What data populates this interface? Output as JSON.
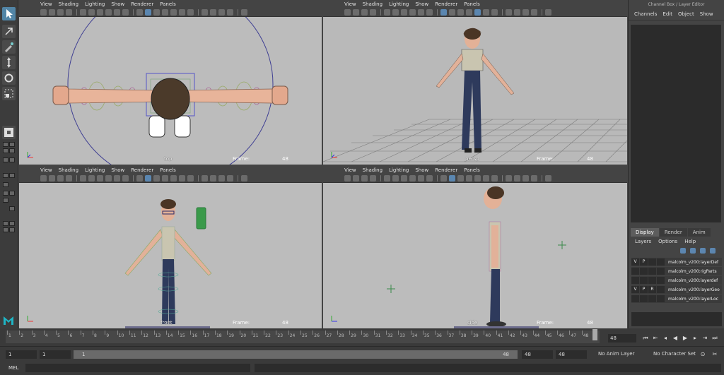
{
  "toolbox": {
    "tools": [
      "select-tool",
      "lasso-tool",
      "paint-select-tool",
      "move-tool",
      "rotate-tool",
      "scale-tool"
    ],
    "logo": "maya-logo"
  },
  "viewports": {
    "top_left": {
      "menu": [
        "View",
        "Shading",
        "Lighting",
        "Show",
        "Renderer",
        "Panels"
      ],
      "camera": "top",
      "frame_label": "Frame:",
      "frame": "48"
    },
    "top_right": {
      "menu": [
        "View",
        "Shading",
        "Lighting",
        "Show",
        "Renderer",
        "Panels"
      ],
      "camera": "persp",
      "frame_label": "Frame:",
      "frame": "48"
    },
    "bottom_left": {
      "menu": [
        "View",
        "Shading",
        "Lighting",
        "Show",
        "Renderer",
        "Panels"
      ],
      "camera": "front",
      "frame_label": "Frame:",
      "frame": "48"
    },
    "bottom_right": {
      "menu": [
        "View",
        "Shading",
        "Lighting",
        "Show",
        "Renderer",
        "Panels"
      ],
      "camera": "side",
      "frame_label": "Frame:",
      "frame": "48"
    }
  },
  "right_panel": {
    "title": "Channel Box / Layer Editor",
    "menu": [
      "Channels",
      "Edit",
      "Object",
      "Show"
    ],
    "layer_tabs": [
      "Display",
      "Render",
      "Anim"
    ],
    "active_tab": "Display",
    "layer_menu": [
      "Layers",
      "Options",
      "Help"
    ],
    "layers": [
      {
        "v": "V",
        "p": "P",
        "r": "",
        "name": "malcolm_v200:layerDef"
      },
      {
        "v": "",
        "p": "",
        "r": "",
        "name": "malcolm_v200:rigParts"
      },
      {
        "v": "",
        "p": "",
        "r": "",
        "name": "malcolm_v200:layerdef"
      },
      {
        "v": "V",
        "p": "P",
        "r": "R",
        "name": "malcolm_v200:layerGeo"
      },
      {
        "v": "",
        "p": "",
        "r": "",
        "name": "malcolm_v200:layerLoc"
      }
    ]
  },
  "timeline": {
    "ticks": [
      "1",
      "2",
      "3",
      "4",
      "5",
      "6",
      "7",
      "8",
      "9",
      "10",
      "11",
      "12",
      "13",
      "14",
      "15",
      "16",
      "17",
      "18",
      "19",
      "20",
      "21",
      "22",
      "23",
      "24",
      "25",
      "26",
      "27",
      "28",
      "29",
      "30",
      "31",
      "32",
      "33",
      "34",
      "35",
      "36",
      "37",
      "38",
      "39",
      "40",
      "41",
      "42",
      "43",
      "44",
      "45",
      "46",
      "47",
      "48"
    ],
    "current_frame": "48",
    "current_frame_field": "48"
  },
  "range": {
    "start_field": "1",
    "playback_start": "1",
    "slider_start": "1",
    "slider_end": "48",
    "playback_end": "48",
    "end_field": "48",
    "anim_layer": "No Anim Layer",
    "character_set": "No Character Set"
  },
  "command_line": {
    "label": "MEL"
  },
  "colors": {
    "selected_tool": "#5285a6",
    "viewport_bg": "#bcbcbc",
    "ui_bg": "#444444"
  }
}
